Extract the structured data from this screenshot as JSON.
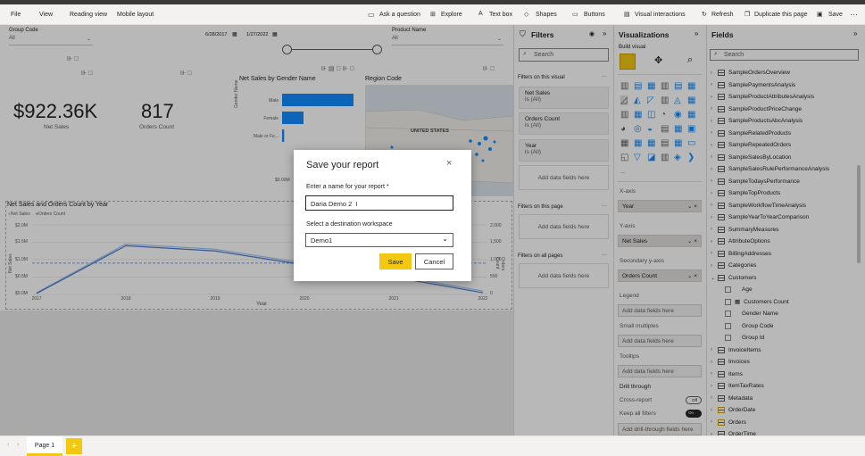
{
  "menu": {
    "items": [
      "File",
      "View",
      "Reading view",
      "Mobile layout"
    ],
    "actions": [
      "Ask a question",
      "Explore",
      "Text box",
      "Shapes",
      "Buttons",
      "Visual interactions",
      "Refresh",
      "Duplicate this page",
      "Save"
    ]
  },
  "slicers": {
    "group_code_label": "Group Code",
    "group_code_value": "All",
    "date_start": "6/28/2017",
    "date_end": "1/27/2022",
    "product_name_label": "Product Name",
    "product_name_value": "All"
  },
  "kpis": {
    "net_sales_value": "$922.36K",
    "net_sales_label": "Net Sales",
    "orders_value": "817",
    "orders_label": "Orders Count"
  },
  "gender_chart": {
    "title": "Net Sales by Gender Name",
    "ylabel": "Gender Name",
    "x_tick": "$0.00M"
  },
  "region_map": {
    "title": "Region Code",
    "country_label": "UNITED STATES"
  },
  "line_chart": {
    "title": "Net Sales and Orders Count by Year",
    "legend": [
      "Net Sales",
      "Orders Count"
    ],
    "ylabel_left": "Net Sales",
    "ylabel_right": "Orders Count",
    "xlabel": "Year",
    "y_left_ticks": [
      "$2.0M",
      "$1.5M",
      "$1.0M",
      "$0.5M",
      "$0.0M"
    ],
    "y_right_ticks": [
      "2,000",
      "1,500",
      "1,000",
      "500",
      "0"
    ],
    "x_ticks": [
      "2017",
      "2018",
      "2019",
      "2020",
      "2021",
      "2022"
    ]
  },
  "chart_data": [
    {
      "type": "bar",
      "title": "Net Sales by Gender Name",
      "categories": [
        "Male",
        "Female",
        "Male or Fe..."
      ],
      "values": [
        0.7,
        0.21,
        0.02
      ],
      "ylabel": "Gender Name"
    },
    {
      "type": "line",
      "title": "Net Sales and Orders Count by Year",
      "x": [
        "2017",
        "2018",
        "2019",
        "2020",
        "2021",
        "2022"
      ],
      "series": [
        {
          "name": "Net Sales",
          "values": [
            0.05,
            1.45,
            1.3,
            0.9,
            0.55,
            0.1
          ]
        },
        {
          "name": "Orders Count",
          "values": [
            0.03,
            1.4,
            1.25,
            0.85,
            0.5,
            0.05
          ]
        }
      ],
      "ylim": [
        0,
        2.0
      ],
      "xlabel": "Year",
      "ylabel": "Net Sales"
    }
  ],
  "filters": {
    "title": "Filters",
    "search_placeholder": "Search",
    "on_visual_label": "Filters on this visual",
    "on_visual": [
      {
        "name": "Net Sales",
        "value": "is (All)"
      },
      {
        "name": "Orders Count",
        "value": "is (All)"
      },
      {
        "name": "Year",
        "value": "is (All)"
      }
    ],
    "add_fields": "Add data fields here",
    "on_page_label": "Filters on this page",
    "on_all_label": "Filters on all pages"
  },
  "viz": {
    "title": "Visualizations",
    "build_label": "Build visual",
    "more": "...",
    "xaxis_label": "X-axis",
    "xaxis_value": "Year",
    "yaxis_label": "Y-axis",
    "yaxis_value": "Net Sales",
    "sec_yaxis_label": "Secondary y-axis",
    "sec_yaxis_value": "Orders Count",
    "legend_label": "Legend",
    "small_multiples_label": "Small multiples",
    "tooltips_label": "Tooltips",
    "drill_label": "Drill through",
    "cross_report_label": "Cross-report",
    "cross_report_state": "Off",
    "keep_filters_label": "Keep all filters",
    "keep_filters_state": "On",
    "add_fields": "Add data fields here",
    "add_drill": "Add drill-through fields here"
  },
  "fields": {
    "title": "Fields",
    "search_placeholder": "Search",
    "items": [
      {
        "name": "SampleOrdersOverview",
        "type": "table"
      },
      {
        "name": "SamplePaymentsAnalysis",
        "type": "table"
      },
      {
        "name": "SampleProductAttributesAnalysis",
        "type": "table"
      },
      {
        "name": "SampleProductPriceChange",
        "type": "table"
      },
      {
        "name": "SampleProductsAbcAnalysis",
        "type": "table"
      },
      {
        "name": "SampleRelatedProducts",
        "type": "table"
      },
      {
        "name": "SampleRepeatedOrders",
        "type": "table"
      },
      {
        "name": "SampleSalesByLocation",
        "type": "table"
      },
      {
        "name": "SampleSalesRulePerformanceAnalysis",
        "type": "table"
      },
      {
        "name": "SampleTodaysPerformance",
        "type": "table"
      },
      {
        "name": "SampleTopProducts",
        "type": "table"
      },
      {
        "name": "SampleWorkflowTimeAnalysis",
        "type": "table"
      },
      {
        "name": "SampleYearToYearComparison",
        "type": "table"
      },
      {
        "name": "SummaryMeasures",
        "type": "table"
      },
      {
        "name": "AttributeOptions",
        "type": "table"
      },
      {
        "name": "BillingAddresses",
        "type": "table"
      },
      {
        "name": "Categories",
        "type": "table"
      },
      {
        "name": "Customers",
        "type": "table-open"
      },
      {
        "name": "Age",
        "type": "field"
      },
      {
        "name": "Customers Count",
        "type": "measure"
      },
      {
        "name": "Gender Name",
        "type": "field"
      },
      {
        "name": "Group Code",
        "type": "field"
      },
      {
        "name": "Group Id",
        "type": "field"
      },
      {
        "name": "InvoiceItems",
        "type": "table"
      },
      {
        "name": "Invoices",
        "type": "table"
      },
      {
        "name": "Items",
        "type": "table"
      },
      {
        "name": "ItemTaxRates",
        "type": "table"
      },
      {
        "name": "Metadata",
        "type": "table"
      },
      {
        "name": "OrderDate",
        "type": "table-used"
      },
      {
        "name": "Orders",
        "type": "table-used"
      },
      {
        "name": "OrderTime",
        "type": "table"
      }
    ]
  },
  "dialog": {
    "title": "Save your report",
    "name_label": "Enter a name for your report *",
    "name_value": "Daria Demo 2",
    "workspace_label": "Select a destination workspace",
    "workspace_value": "Demo1",
    "save": "Save",
    "cancel": "Cancel"
  },
  "tabs": {
    "page": "Page 1",
    "add": "+"
  },
  "colors": {
    "accent_yellow": "#f2c811",
    "bar_blue": "#118dff",
    "line_light": "#a0c4f0",
    "line_dark": "#4a7ccf"
  }
}
